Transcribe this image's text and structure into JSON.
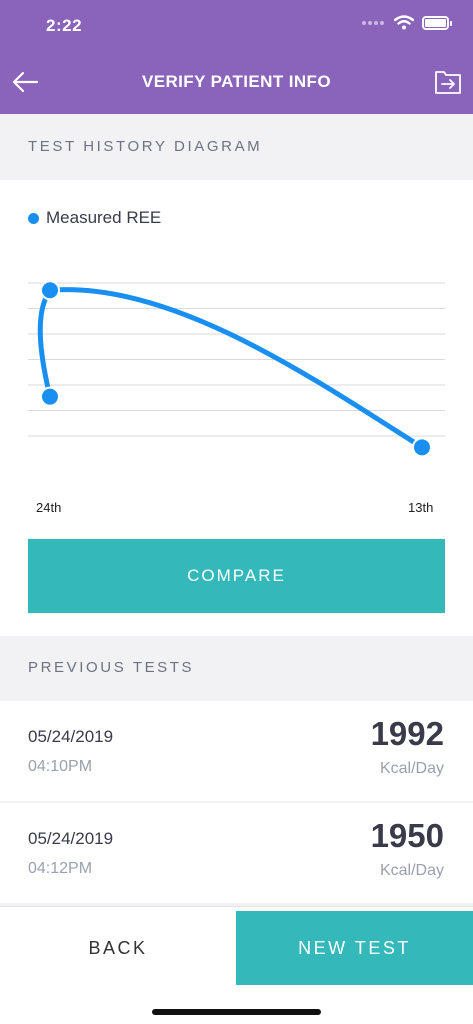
{
  "status_bar": {
    "time": "2:22"
  },
  "header": {
    "title": "VERIFY PATIENT INFO"
  },
  "sections": {
    "history_label": "TEST HISTORY DIAGRAM",
    "previous_label": "PREVIOUS TESTS"
  },
  "chart_data": {
    "type": "line",
    "categories": [
      "24th",
      "24th",
      "13th"
    ],
    "series": [
      {
        "name": "Measured REE",
        "values": [
          1950,
          1992,
          1930
        ],
        "color": "#1a8ff2"
      }
    ],
    "x_tick_labels": [
      "24th",
      "13th"
    ],
    "grid": true,
    "legend": "top-left"
  },
  "buttons": {
    "compare": "COMPARE",
    "back": "BACK",
    "new_test": "NEW TEST"
  },
  "previous_tests": [
    {
      "date": "05/24/2019",
      "time": "04:10PM",
      "value": "1992",
      "unit": "Kcal/Day"
    },
    {
      "date": "05/24/2019",
      "time": "04:12PM",
      "value": "1950",
      "unit": "Kcal/Day"
    }
  ],
  "colors": {
    "header": "#8a63bb",
    "accent": "#35b8ba",
    "series": "#1a8ff2"
  }
}
